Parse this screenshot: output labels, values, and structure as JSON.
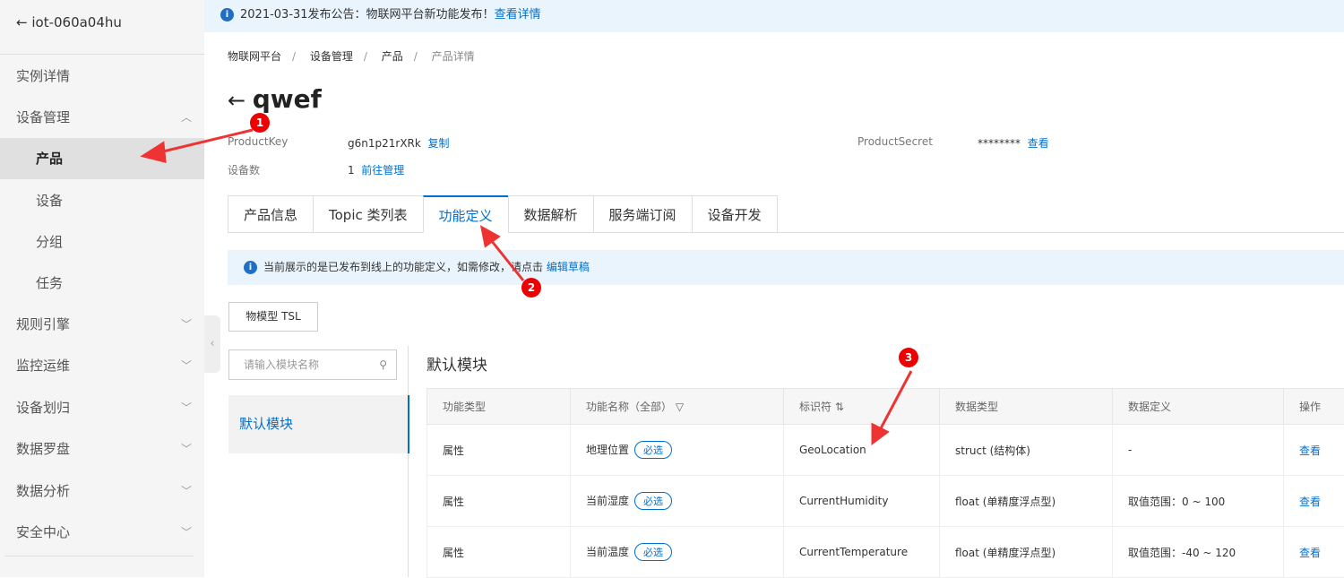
{
  "sidebar": {
    "title": "iot-060a04hu",
    "items": [
      {
        "label": "实例详情"
      },
      {
        "label": "设备管理"
      },
      {
        "label": "产品"
      },
      {
        "label": "设备"
      },
      {
        "label": "分组"
      },
      {
        "label": "任务"
      },
      {
        "label": "规则引擎"
      },
      {
        "label": "监控运维"
      },
      {
        "label": "设备划归"
      },
      {
        "label": "数据罗盘"
      },
      {
        "label": "数据分析"
      },
      {
        "label": "安全中心"
      }
    ]
  },
  "notice": {
    "text": "2021-03-31发布公告：物联网平台新功能发布！",
    "link": "查看详情"
  },
  "breadcrumb": [
    "物联网平台",
    "设备管理",
    "产品",
    "产品详情"
  ],
  "product": {
    "name": "qwef",
    "key_label": "ProductKey",
    "key": "g6n1p21rXRk",
    "copy": "复制",
    "secret_label": "ProductSecret",
    "secret": "********",
    "view": "查看",
    "devices_label": "设备数",
    "devices": "1",
    "manage": "前往管理"
  },
  "tabs": [
    "产品信息",
    "Topic 类列表",
    "功能定义",
    "数据解析",
    "服务端订阅",
    "设备开发"
  ],
  "alert": {
    "text": "当前展示的是已发布到线上的功能定义，如需修改，请点击",
    "link": "编辑草稿"
  },
  "tsl_button": "物模型 TSL",
  "search_placeholder": "请输入模块名称",
  "module": "默认模块",
  "table": {
    "headers": [
      "功能类型",
      "功能名称（全部）",
      "标识符",
      "数据类型",
      "数据定义",
      "操作"
    ],
    "rows": [
      {
        "type": "属性",
        "name": "地理位置",
        "tag": "必选",
        "id": "GeoLocation",
        "dtype": "struct (结构体)",
        "def": "-",
        "op": "查看"
      },
      {
        "type": "属性",
        "name": "当前湿度",
        "tag": "必选",
        "id": "CurrentHumidity",
        "dtype": "float (单精度浮点型)",
        "def": "取值范围：0 ~ 100",
        "op": "查看"
      },
      {
        "type": "属性",
        "name": "当前温度",
        "tag": "必选",
        "id": "CurrentTemperature",
        "dtype": "float (单精度浮点型)",
        "def": "取值范围：-40 ~ 120",
        "op": "查看"
      }
    ]
  },
  "markers": [
    "1",
    "2",
    "3"
  ]
}
